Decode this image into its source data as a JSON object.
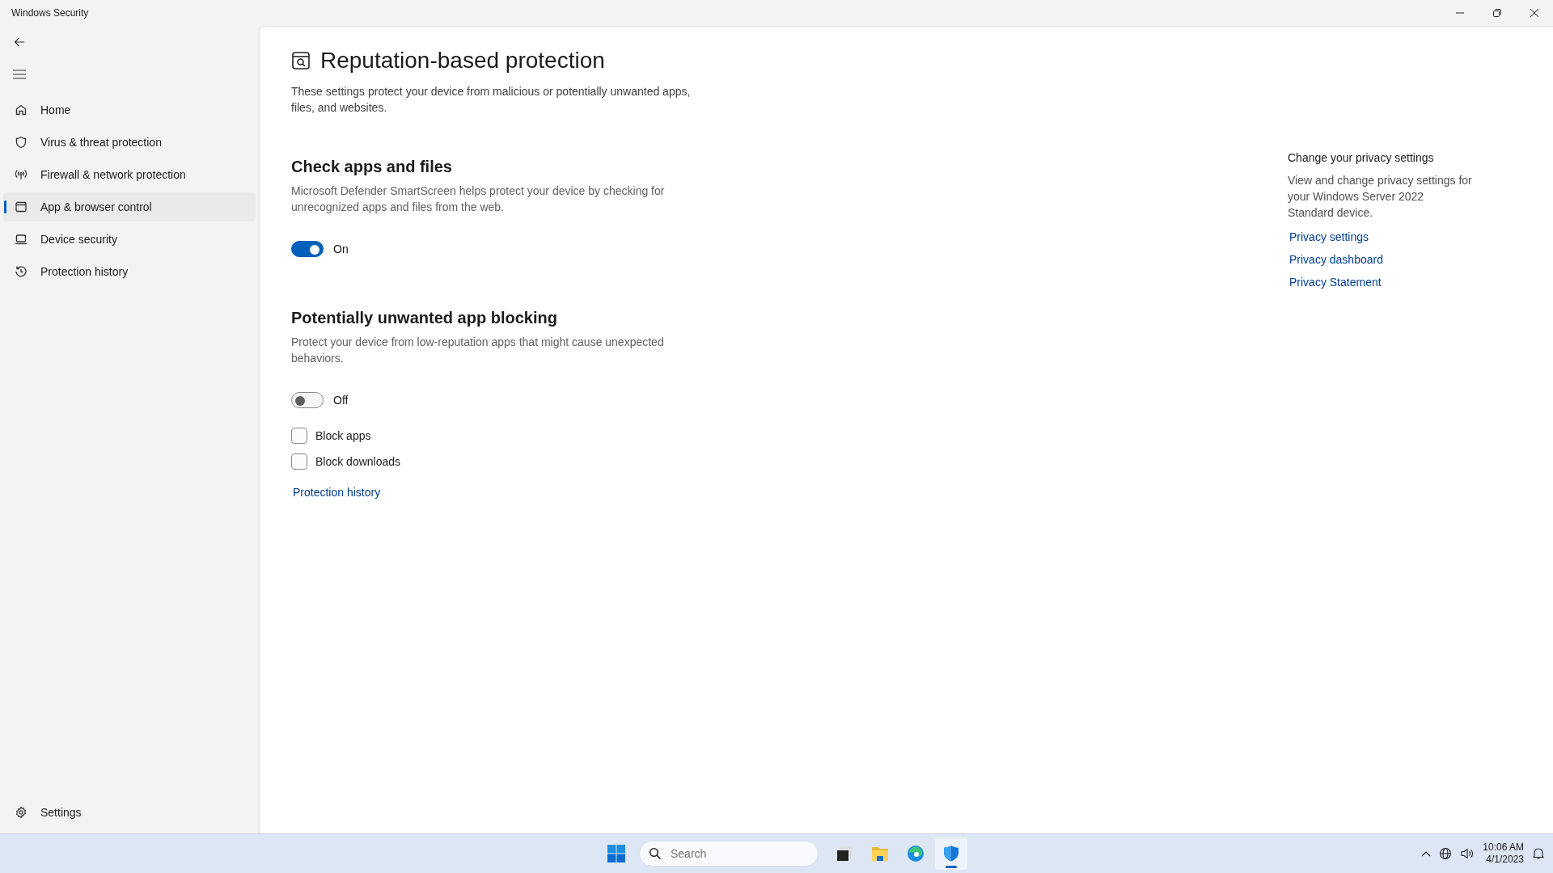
{
  "window": {
    "title": "Windows Security"
  },
  "nav": {
    "items": [
      {
        "label": "Home",
        "kind": "home",
        "selected": false
      },
      {
        "label": "Virus & threat protection",
        "kind": "shield",
        "selected": false
      },
      {
        "label": "Firewall & network protection",
        "kind": "antenna",
        "selected": false
      },
      {
        "label": "App & browser control",
        "kind": "window",
        "selected": true
      },
      {
        "label": "Device security",
        "kind": "laptop",
        "selected": false
      },
      {
        "label": "Protection history",
        "kind": "history",
        "selected": false
      }
    ],
    "settings": {
      "label": "Settings"
    }
  },
  "page": {
    "title": "Reputation-based protection",
    "description": "These settings protect your device from malicious or potentially unwanted apps, files, and websites."
  },
  "sections": [
    {
      "heading": "Check apps and files",
      "description": "Microsoft Defender SmartScreen helps protect your device by checking for unrecognized apps and files from the web.",
      "toggle": {
        "on": true,
        "label": "On"
      }
    },
    {
      "heading": "Potentially unwanted app blocking",
      "description": "Protect your device from low-reputation apps that might cause unexpected behaviors.",
      "toggle": {
        "on": false,
        "label": "Off"
      },
      "checkboxes": [
        {
          "label": "Block apps",
          "checked": false
        },
        {
          "label": "Block downloads",
          "checked": false
        }
      ],
      "link": "Protection history"
    }
  ],
  "aside": {
    "heading": "Change your privacy settings",
    "description": "View and change privacy settings for your Windows Server 2022 Standard device.",
    "links": [
      "Privacy settings",
      "Privacy dashboard",
      "Privacy Statement"
    ]
  },
  "taskbar": {
    "search": {
      "placeholder": "Search"
    },
    "apps": [
      {
        "kind": "start",
        "selected": false
      },
      {
        "kind": "search"
      },
      {
        "kind": "terminal",
        "selected": false
      },
      {
        "kind": "folder",
        "selected": false
      },
      {
        "kind": "browser",
        "selected": false
      },
      {
        "kind": "security",
        "selected": true
      }
    ],
    "tray": {
      "time": "10:06 AM",
      "date": "4/1/2023"
    }
  }
}
